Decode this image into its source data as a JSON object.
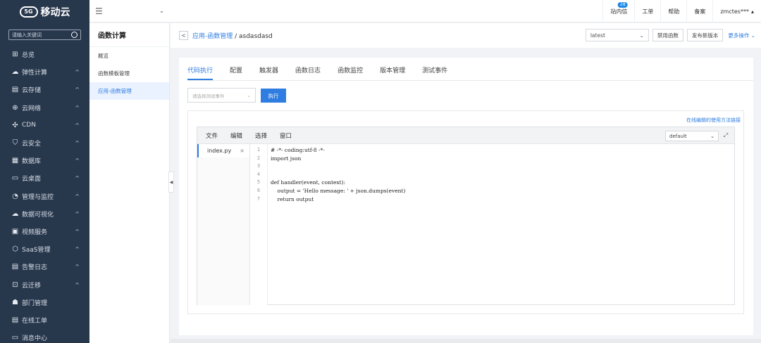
{
  "brand": {
    "logo_mark": "5G",
    "name": "移动云"
  },
  "nav": {
    "search_placeholder": "请输入关键词",
    "items": [
      {
        "icon": "⊞",
        "icon_name": "grid-icon",
        "label": "总览",
        "chevron": ""
      },
      {
        "icon": "☁",
        "icon_name": "cloud-icon",
        "label": "弹性计算",
        "chevron": "^"
      },
      {
        "icon": "▤",
        "icon_name": "storage-icon",
        "label": "云存储",
        "chevron": "^"
      },
      {
        "icon": "⊕",
        "icon_name": "globe-icon",
        "label": "云网络",
        "chevron": "^"
      },
      {
        "icon": "✣",
        "icon_name": "cdn-icon",
        "label": "CDN",
        "chevron": "^"
      },
      {
        "icon": "⛉",
        "icon_name": "shield-icon",
        "label": "云安全",
        "chevron": "^"
      },
      {
        "icon": "▦",
        "icon_name": "database-icon",
        "label": "数据库",
        "chevron": "^"
      },
      {
        "icon": "▭",
        "icon_name": "desktop-icon",
        "label": "云桌面",
        "chevron": "^"
      },
      {
        "icon": "◔",
        "icon_name": "monitor-icon",
        "label": "管理与监控",
        "chevron": "^"
      },
      {
        "icon": "☁",
        "icon_name": "chart-cloud-icon",
        "label": "数据可视化",
        "chevron": "^"
      },
      {
        "icon": "▣",
        "icon_name": "video-icon",
        "label": "视频服务",
        "chevron": "^"
      },
      {
        "icon": "⬡",
        "icon_name": "saas-icon",
        "label": "SaaS管理",
        "chevron": "^"
      },
      {
        "icon": "▤",
        "icon_name": "log-icon",
        "label": "告警日志",
        "chevron": "^"
      },
      {
        "icon": "⊡",
        "icon_name": "migrate-icon",
        "label": "云迁移",
        "chevron": "^"
      },
      {
        "icon": "☗",
        "icon_name": "department-icon",
        "label": "部门管理",
        "chevron": ""
      },
      {
        "icon": "▤",
        "icon_name": "ticket-icon",
        "label": "在线工单",
        "chevron": ""
      },
      {
        "icon": "▭",
        "icon_name": "message-icon",
        "label": "消息中心",
        "chevron": ""
      }
    ]
  },
  "topbar": {
    "menu_icon": "☰",
    "dropdown_icon": "⌄",
    "links": [
      {
        "label": "站内信",
        "badge": "28"
      },
      {
        "label": "工单",
        "badge": ""
      },
      {
        "label": "帮助",
        "badge": ""
      },
      {
        "label": "备案",
        "badge": ""
      },
      {
        "label": "zmctes***",
        "badge": ""
      }
    ],
    "user_caret": "▴"
  },
  "subside": {
    "title": "函数计算",
    "items": [
      {
        "label": "概览",
        "active": false
      },
      {
        "label": "函数模板管理",
        "active": false
      },
      {
        "label": "应用-函数管理",
        "active": true
      }
    ]
  },
  "breadcrumb": {
    "back": "<",
    "link": "应用-函数管理",
    "sep": " / ",
    "current": "asdasdasd",
    "version": "latest",
    "disable_btn": "禁用函数",
    "publish_btn": "发布新版本",
    "more_ops": "更多操作 ⌄"
  },
  "tabs": [
    "代码执行",
    "配置",
    "触发器",
    "函数日志",
    "函数监控",
    "版本管理",
    "测试事件"
  ],
  "active_tab": 0,
  "exec": {
    "event_placeholder": "请选择测试事件",
    "run_label": "执行"
  },
  "editor": {
    "help_link": "在线编辑的使用方法链接",
    "menu": [
      "文件",
      "编辑",
      "选择",
      "窗口"
    ],
    "theme": "default",
    "file": "index.py",
    "line_numbers": [
      "1",
      "2",
      "3",
      "4",
      "5",
      "6",
      "7"
    ],
    "code_lines": [
      "# -*- coding:utf-8 -*-",
      "import json",
      "",
      "",
      "def handler(event, context):",
      "    output = 'Hello message: ' + json.dumps(event)",
      "    return output"
    ]
  }
}
